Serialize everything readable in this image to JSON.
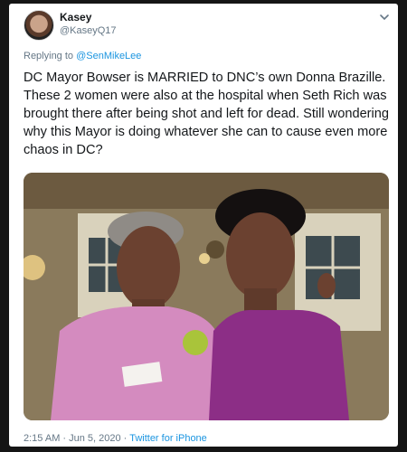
{
  "author": {
    "name": "Kasey",
    "handle": "@KaseyQ17",
    "avatar_icon": "profile-photo"
  },
  "reply": {
    "prefix": "Replying to ",
    "to": "@SenMikeLee"
  },
  "tweet_text": "DC Mayor Bowser is MARRIED to DNC’s own Donna Brazille. These 2 women were also at the hospital when Seth Rich was brought there after being shot and left for dead. Still wondering why this Mayor is doing whatever she can to cause even more chaos in DC?",
  "media": {
    "type": "photo"
  },
  "meta": {
    "timestamp": "2:15 AM · Jun 5, 2020 · ",
    "source": "Twitter for iPhone"
  },
  "colors": {
    "link": "#1b95e0",
    "secondary": "#657786",
    "text": "#14171a"
  }
}
